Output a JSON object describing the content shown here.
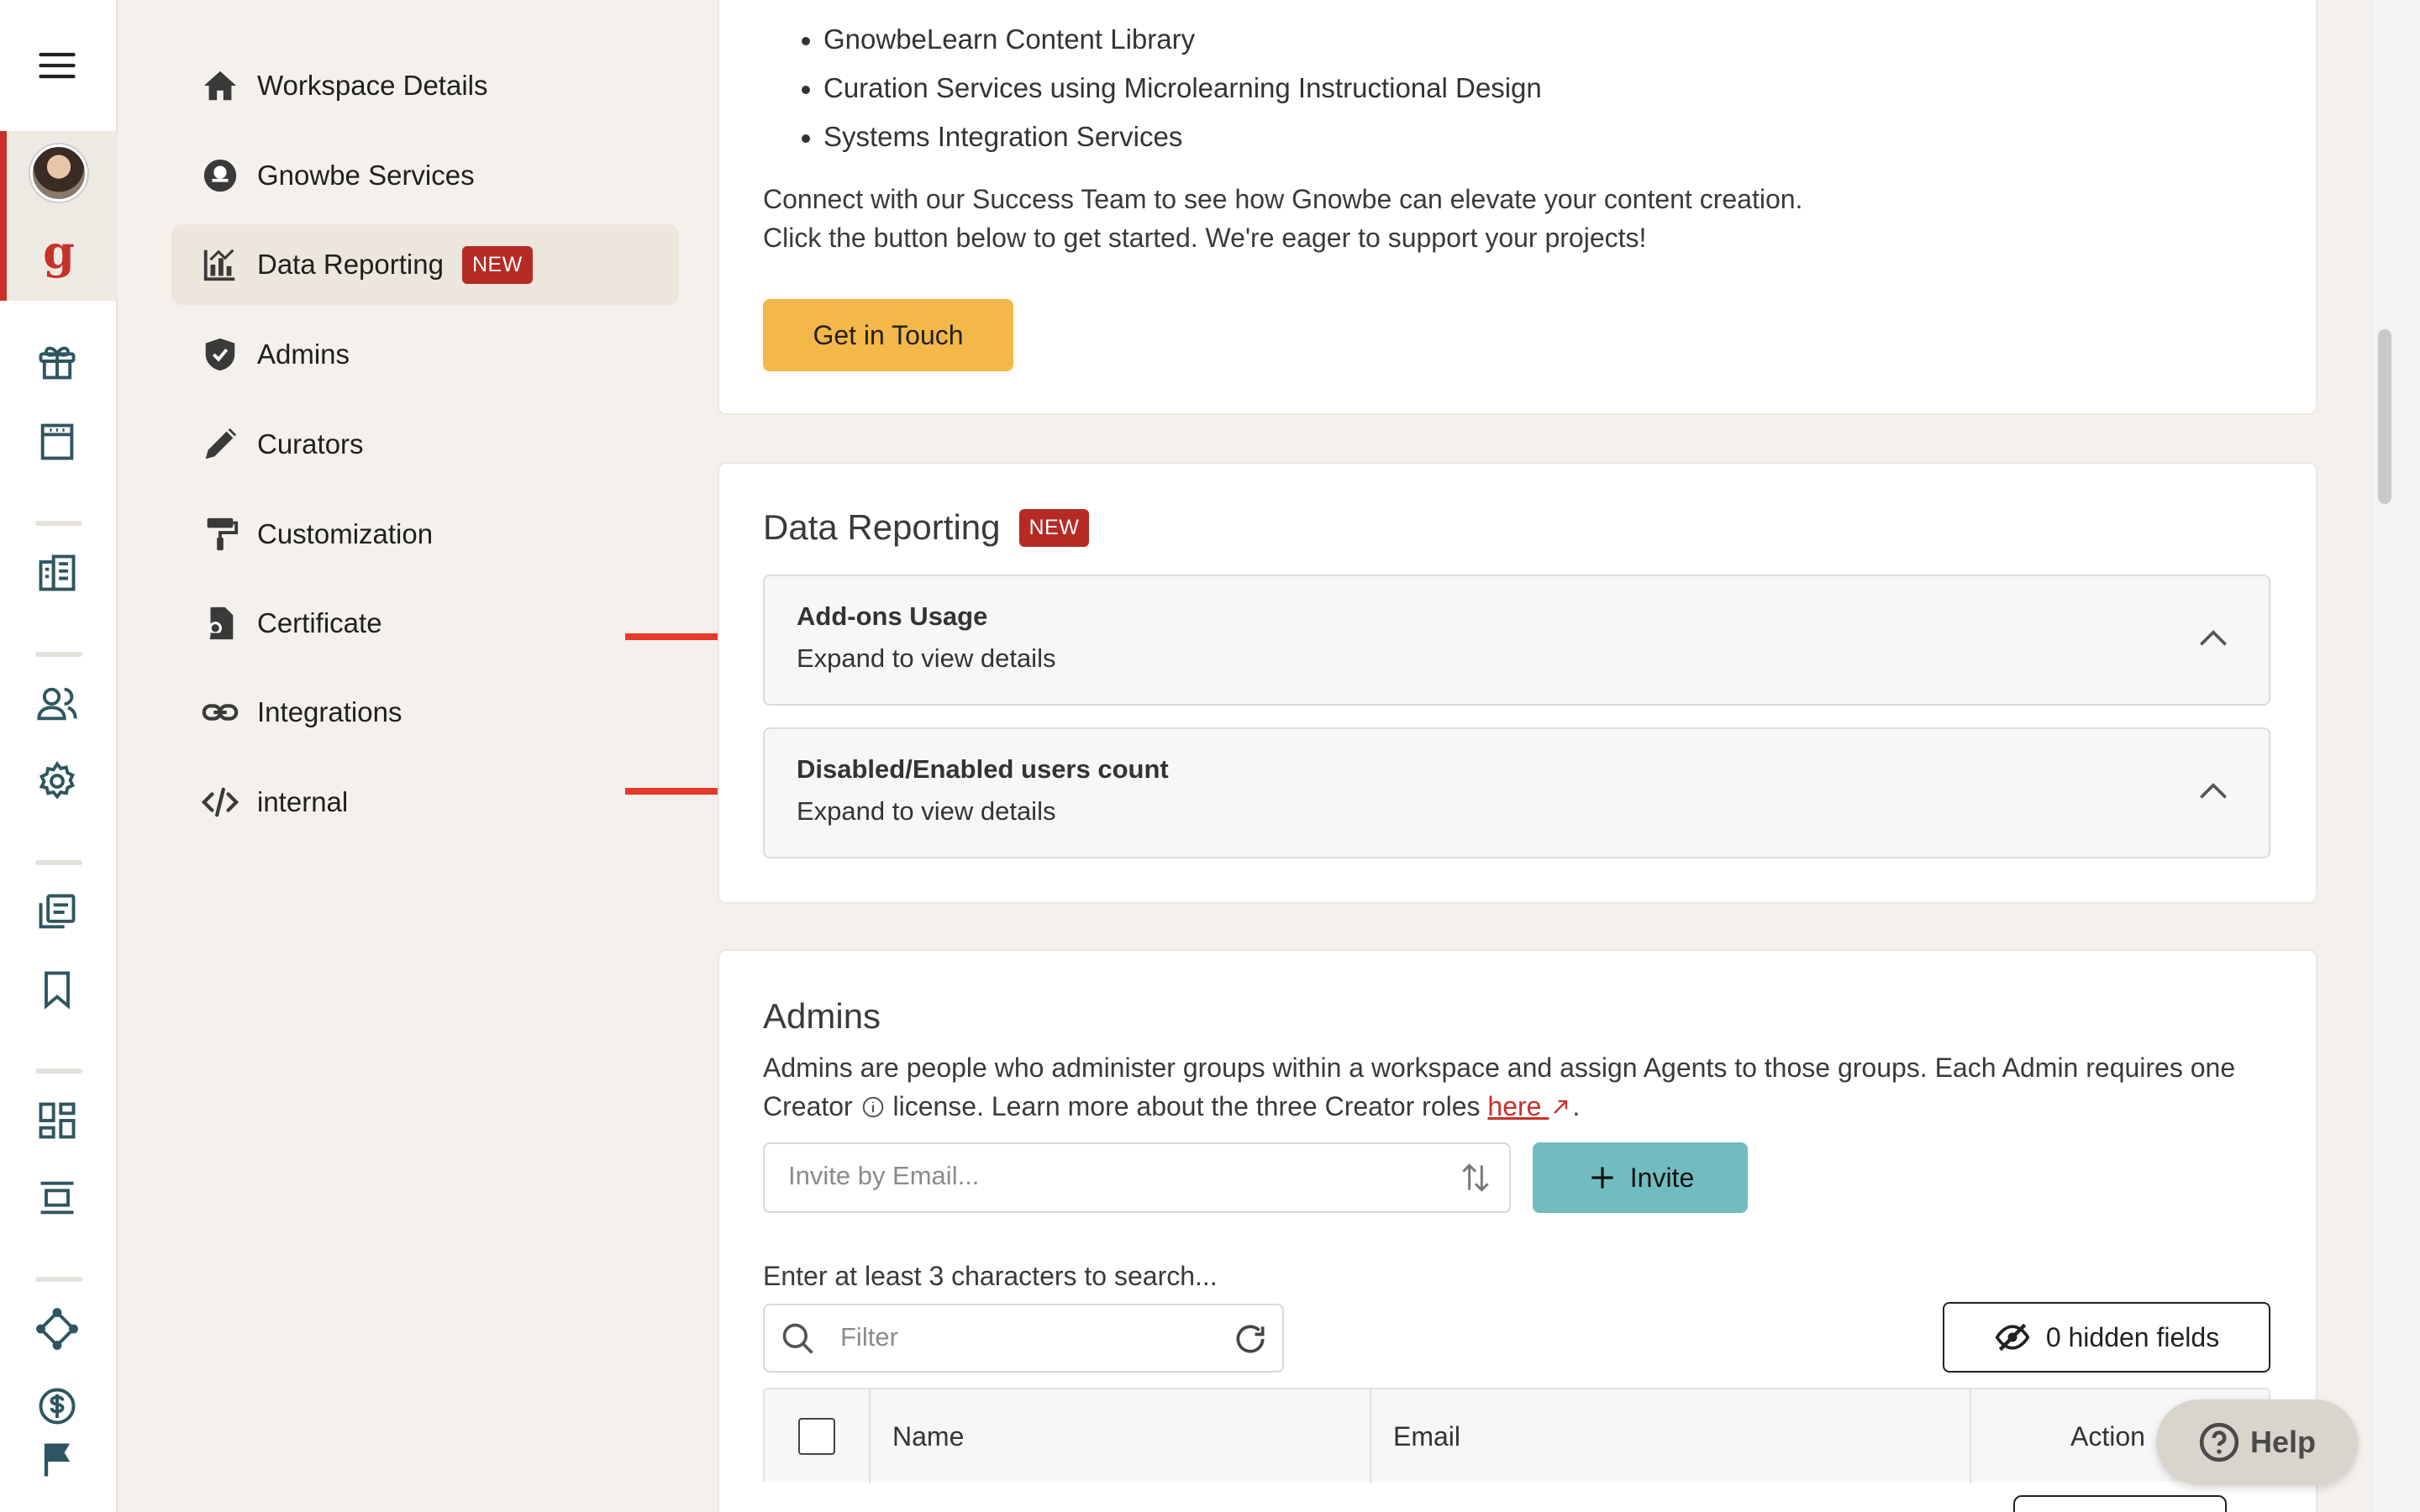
{
  "rail": {
    "menu_icon": "hamburger-menu-icon",
    "items": [
      "gift-icon",
      "building-icon",
      "dashboard-icon",
      "users-icon",
      "settings-icon",
      "library-icon",
      "bookmark-icon",
      "apps-icon",
      "layout-icon",
      "network-icon",
      "dollar-icon",
      "flag-icon"
    ]
  },
  "sidebar": {
    "items": [
      {
        "label": "Workspace Details",
        "icon": "home-icon"
      },
      {
        "label": "Gnowbe Services",
        "icon": "services-icon"
      },
      {
        "label": "Data Reporting",
        "icon": "chart-icon",
        "badge": "NEW"
      },
      {
        "label": "Admins",
        "icon": "shield-icon"
      },
      {
        "label": "Curators",
        "icon": "pencil-icon"
      },
      {
        "label": "Customization",
        "icon": "paint-roller-icon"
      },
      {
        "label": "Certificate",
        "icon": "certificate-icon"
      },
      {
        "label": "Integrations",
        "icon": "link-icon"
      },
      {
        "label": "internal",
        "icon": "code-icon"
      }
    ]
  },
  "services": {
    "bullets": [
      "GnowbeLearn Content Library",
      "Curation Services using Microlearning Instructional Design",
      "Systems Integration Services"
    ],
    "line1": "Connect with our Success Team to see how Gnowbe can elevate your content creation.",
    "line2": "Click the button below to get started. We're eager to support your projects!",
    "button": "Get in Touch"
  },
  "data_reporting": {
    "title": "Data Reporting",
    "badge": "NEW",
    "panels": [
      {
        "title": "Add-ons Usage",
        "subtitle": "Expand to view details"
      },
      {
        "title": "Disabled/Enabled users count",
        "subtitle": "Expand to view details"
      }
    ]
  },
  "admins": {
    "title": "Admins",
    "desc_part1": "Admins are people who administer groups within a workspace and assign Agents to those groups. Each Admin requires one",
    "desc_part2a": "Creator",
    "desc_part2b": "license. Learn more about the three Creator roles",
    "link": "here",
    "invite_placeholder": "Invite by Email...",
    "invite_button": "Invite",
    "search_hint": "Enter at least 3 characters to search...",
    "filter_placeholder": "Filter",
    "hidden_fields": "0 hidden fields",
    "columns": [
      "Name",
      "Email",
      "Action"
    ]
  },
  "help": "Help",
  "colors": {
    "accent": "#c8302a",
    "badge": "#b62a24",
    "cta": "#f4b74a",
    "invite": "#71bcbf"
  }
}
